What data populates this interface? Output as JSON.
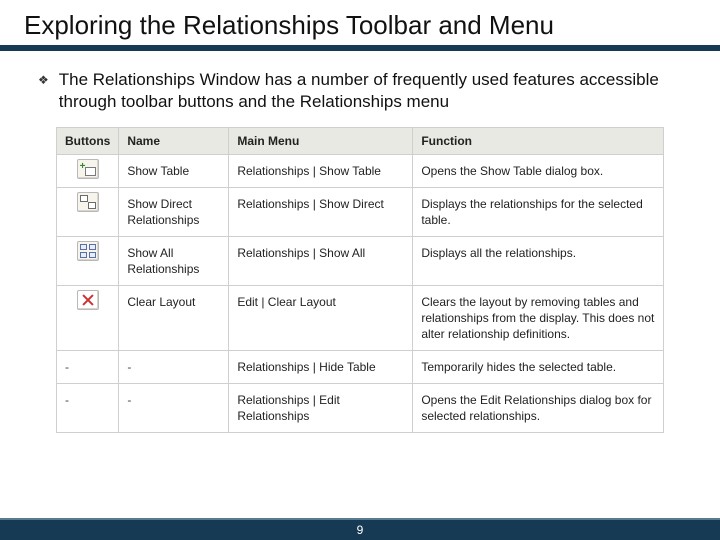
{
  "title": "Exploring the Relationships Toolbar and Menu",
  "bullet": "The Relationships Window has a number of frequently used features accessible through toolbar buttons and the Relationships menu",
  "table": {
    "headers": {
      "buttons": "Buttons",
      "name": "Name",
      "menu": "Main Menu",
      "function": "Function"
    },
    "rows": [
      {
        "icon": "show-table",
        "name": "Show Table",
        "menu": "Relationships | Show Table",
        "func": "Opens the Show Table dialog box."
      },
      {
        "icon": "show-direct",
        "name": "Show Direct Relationships",
        "menu": "Relationships | Show Direct",
        "func": "Displays the relationships for the selected table."
      },
      {
        "icon": "show-all",
        "name": "Show All Relationships",
        "menu": "Relationships | Show All",
        "func": "Displays all the relationships."
      },
      {
        "icon": "clear",
        "name": "Clear Layout",
        "menu": "Edit | Clear Layout",
        "func": "Clears the layout by removing tables and relationships from the display. This does not alter relationship definitions."
      },
      {
        "icon": "-",
        "name": "-",
        "menu": "Relationships | Hide Table",
        "func": "Temporarily hides the selected table."
      },
      {
        "icon": "-",
        "name": "-",
        "menu": "Relationships | Edit Relationships",
        "func": "Opens the Edit Relationships dialog box for selected relationships."
      }
    ]
  },
  "page_number": "9"
}
